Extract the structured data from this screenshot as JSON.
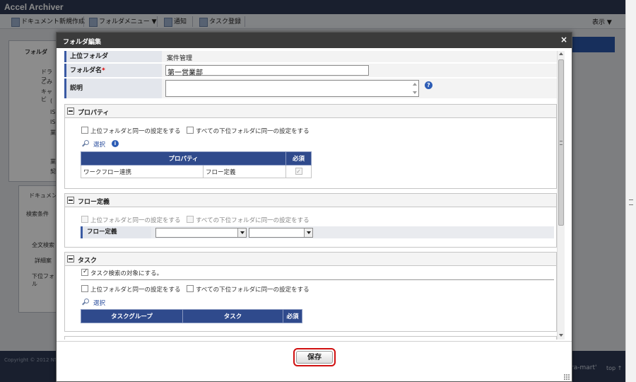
{
  "app": {
    "title": "Accel Archiver",
    "toolbar": {
      "new_document": "ドキュメント新規作成",
      "folder_menu": "フォルダメニュー ▼",
      "notify": "通知",
      "register_task": "タスク登録",
      "display": "表示 ▼"
    },
    "left_panel": {
      "title": "フォルダ",
      "items": [
        "ドラフ",
        "ごみ",
        "キャビ",
        "(",
        "IS",
        "IS",
        "業",
        "業",
        "契"
      ]
    },
    "search_panel": {
      "tab": "ドキュメン",
      "search_conditions": "検索条件",
      "fulltext": "全文検索",
      "details": "詳細案",
      "subfolder": "下位フォル"
    },
    "footer": {
      "copyright": "Copyright © 2012 NT",
      "logo": "ra-mart'",
      "top_link": "top ↑"
    }
  },
  "dialog": {
    "title": "フォルダ編集",
    "close_glyph": "×",
    "fields": {
      "parent_label": "上位フォルダ",
      "parent_value": "案件管理",
      "name_label": "フォルダ名",
      "name_required": "*",
      "name_value": "第一営業部",
      "desc_label": "説明",
      "desc_value": ""
    },
    "sections": {
      "property": {
        "title": "プロパティ",
        "inherit_parent": "上位フォルダと同一の設定をする",
        "apply_children": "すべての下位フォルダに同一の設定をする",
        "select": "選択",
        "table_headers": [
          "プロパティ",
          "必須"
        ],
        "rows": [
          {
            "name": "ワークフロー連携",
            "value": "フロー定義",
            "required": true
          }
        ]
      },
      "flow": {
        "title": "フロー定義",
        "inherit_parent": "上位フォルダと同一の設定をする",
        "apply_children": "すべての下位フォルダに同一の設定をする",
        "field_label": "フロー定義",
        "select1_value": "",
        "select2_value": ""
      },
      "task": {
        "title": "タスク",
        "search_target": "タスク検索の対象にする。",
        "inherit_parent": "上位フォルダと同一の設定をする",
        "apply_children": "すべての下位フォルダに同一の設定をする",
        "select": "選択",
        "table_headers": [
          "タスクグループ",
          "タスク",
          "必須"
        ]
      }
    },
    "save_label": "保存"
  },
  "colors": {
    "header_bg": "#2e3a55",
    "table_header": "#2f4a8c",
    "save_highlight": "#d01010"
  }
}
